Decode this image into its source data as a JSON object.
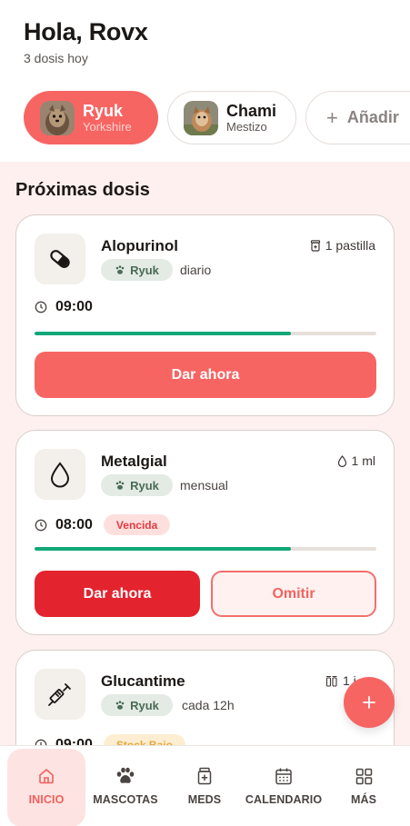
{
  "header": {
    "greeting": "Hola, Rovx",
    "subtitle": "3 dosis hoy"
  },
  "pets": [
    {
      "name": "Ryuk",
      "breed": "Yorkshire",
      "active": true
    },
    {
      "name": "Chami",
      "breed": "Mestizo",
      "active": false
    }
  ],
  "add_pet": {
    "plus": "+",
    "label": "Añadir"
  },
  "section": {
    "title": "Próximas dosis"
  },
  "doses": [
    {
      "name": "Alopurinol",
      "pet": "Ryuk",
      "frequency": "diario",
      "amount": "1 pastilla",
      "time": "09:00",
      "progress": 0.75,
      "icon": "pill-icon",
      "primary_action": "Dar ahora"
    },
    {
      "name": "Metalgial",
      "pet": "Ryuk",
      "frequency": "mensual",
      "amount": "1 ml",
      "time": "08:00",
      "status": "Vencida",
      "progress": 0.75,
      "icon": "drop-icon",
      "primary_action": "Dar ahora",
      "secondary_action": "Omitir"
    },
    {
      "name": "Glucantime",
      "pet": "Ryuk",
      "frequency": "cada 12h",
      "amount": "1 i",
      "time": "09:00",
      "status": "Stock Bajo",
      "icon": "syringe-icon"
    }
  ],
  "fab": {
    "label": "+"
  },
  "nav": {
    "home": "INICIO",
    "pets": "MASCOTAS",
    "meds": "MEDS",
    "calendar": "CALENDARIO",
    "more": "MÁS"
  },
  "colors": {
    "accent": "#f76563",
    "danger": "#e3242f",
    "success": "#12a878",
    "background": "#fdf0ef"
  }
}
